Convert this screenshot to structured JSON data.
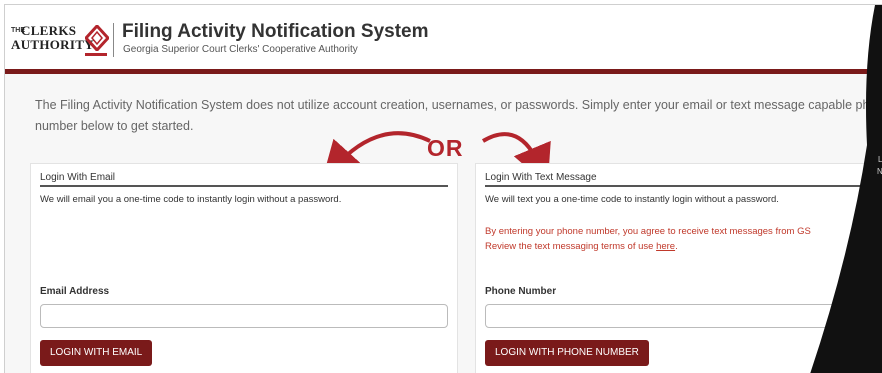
{
  "header": {
    "logo_the": "THE",
    "logo_clerks": "CLERKS",
    "logo_authority": "AUTHORITY",
    "title": "Filing Activity Notification System",
    "subtitle": "Georgia Superior Court Clerks' Cooperative Authority"
  },
  "intro": "The Filing Activity Notification System does not utilize account creation, usernames, or passwords. Simply enter your email or text message capable phon number below to get started.",
  "or_label": "OR",
  "email_card": {
    "heading": "Login With Email",
    "description": "We will email you a one-time code to instantly login without a password.",
    "field_label": "Email Address",
    "field_value": "",
    "button_label": "LOGIN WITH EMAIL"
  },
  "text_card": {
    "heading": "Login With Text Message",
    "description": "We will text you a one-time code to instantly login without a password.",
    "terms_line1": "By entering your phone number, you agree to receive text messages from GS",
    "terms_line2_prefix": "Review the text messaging terms of use ",
    "terms_link": "here",
    "terms_line2_suffix": ".",
    "field_label": "Phone Number",
    "field_value": "",
    "button_label": "LOGIN WITH PHONE NUMBER"
  },
  "overlay": {
    "partial_text_1": "L",
    "partial_text_2": "N"
  },
  "colors": {
    "brand": "#7a1a1a",
    "accent": "#b3252c",
    "terms_text": "#c0392b"
  }
}
